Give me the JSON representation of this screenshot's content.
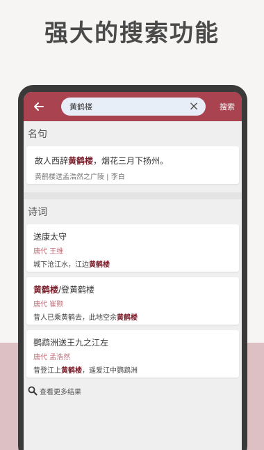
{
  "promo": {
    "headline": "强大的搜索功能"
  },
  "appbar": {
    "search_value": "黄鹤楼",
    "search_button": "搜索"
  },
  "sections": {
    "quotes_title": "名句",
    "poems_title": "诗词"
  },
  "quote": {
    "pre": "故人西辞",
    "hl": "黄鹤楼",
    "post": "，烟花三月下扬州。",
    "source": "黄鹤楼送孟浩然之广陵 | 李白"
  },
  "poems": [
    {
      "title_hl": "",
      "title": "送康太守",
      "meta": "唐代 王维",
      "line_pre": "城下沧江水，江边",
      "line_hl": "黄鹤楼",
      "line_post": ""
    },
    {
      "title_hl": "黄鹤楼",
      "title": "/登黄鹤楼",
      "meta": "唐代 崔颢",
      "line_pre": "昔人已乘黄鹤去，此地空余",
      "line_hl": "黄鹤楼",
      "line_post": ""
    },
    {
      "title_hl": "",
      "title": "鹦鹉洲送王九之江左",
      "meta": "唐代 孟浩然",
      "line_pre": "昔登江上",
      "line_hl": "黄鹤楼",
      "line_post": "，遥爱江中鹦鹉洲"
    }
  ],
  "more_results": "查看更多结果",
  "icons": {
    "back": "arrow-left-icon",
    "clear": "close-icon",
    "more": "search-icon"
  },
  "colors": {
    "primary": "#a8434f",
    "highlight": "#7a1f2b",
    "meta": "#c0707a"
  }
}
